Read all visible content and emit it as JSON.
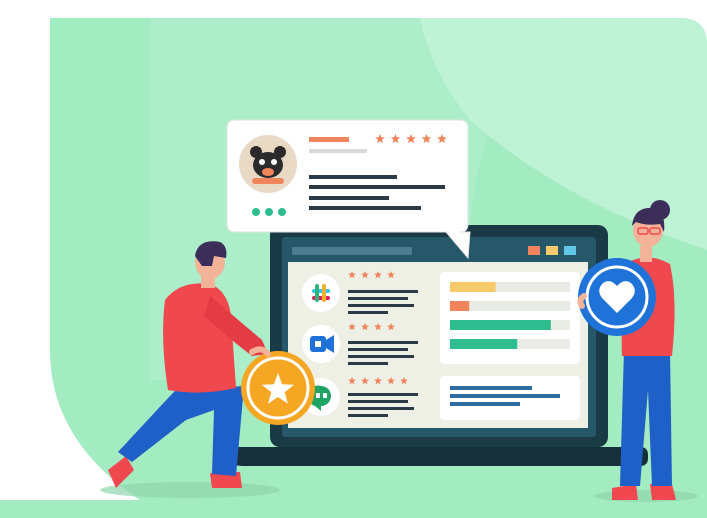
{
  "review_card": {
    "rating_stars": 5,
    "avatar_icon": "bear-face-icon"
  },
  "reviews": [
    {
      "app_icon": "slack-logo-icon",
      "rating_stars": 4
    },
    {
      "app_icon": "google-meet-logo-icon",
      "rating_stars": 4
    },
    {
      "app_icon": "google-hangouts-logo-icon",
      "rating_stars": 5
    }
  ],
  "score_panel": {
    "bars": [
      {
        "color": "#f6c96a",
        "level": 0.38
      },
      {
        "color": "#f0845c",
        "level": 0.16
      },
      {
        "color": "#2ebd8f",
        "level": 0.84
      },
      {
        "color": "#2ebd8f",
        "level": 0.56
      }
    ]
  },
  "colors": {
    "background_green": "#9ae6b8",
    "laptop_dark": "#1a3a45",
    "screen_bg": "#eef0e6",
    "accent_star": "#f0845c",
    "person_shirt": "#f0484f",
    "person_pants": "#1f5fc8",
    "heart_badge": "#1e72d8",
    "star_badge": "#f5a623"
  },
  "decor_icons": [
    "star-badge-icon",
    "heart-badge-icon"
  ]
}
